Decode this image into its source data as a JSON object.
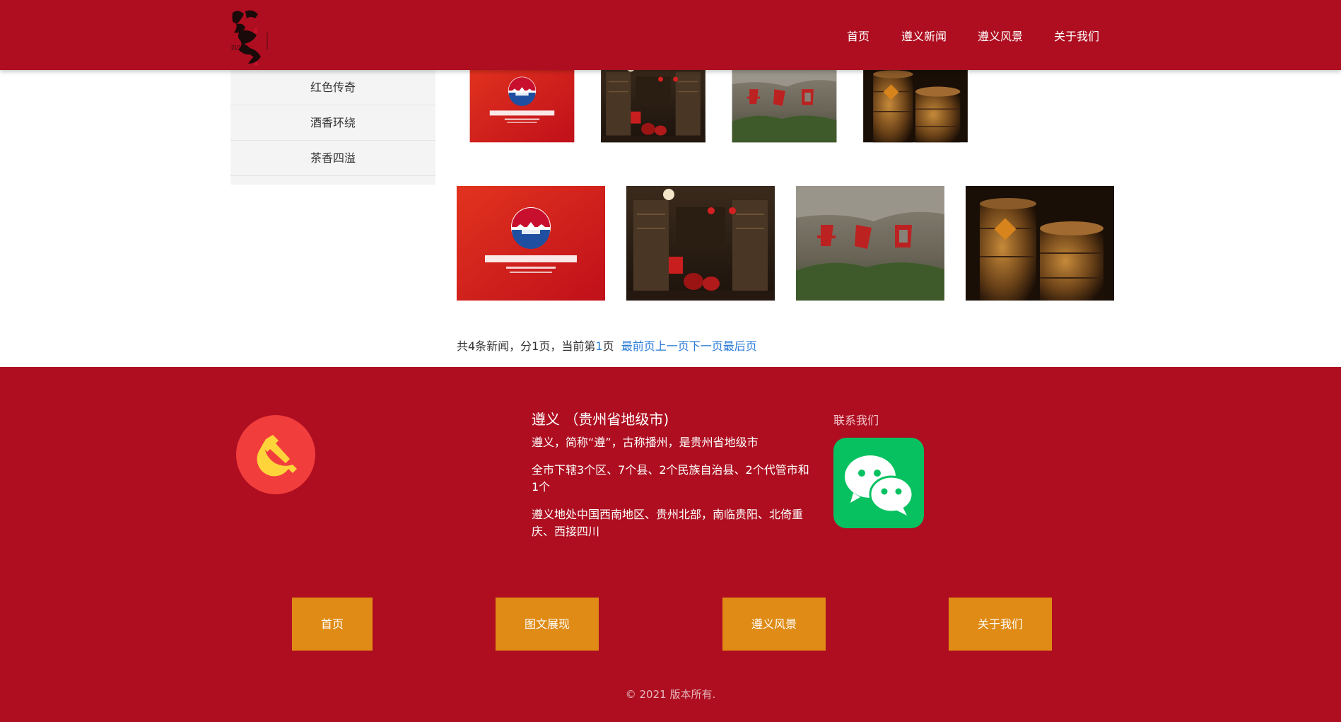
{
  "header": {
    "logo_alt": "醉美遵义",
    "nav": [
      "首页",
      "遵义新闻",
      "遵义风景",
      "关于我们"
    ]
  },
  "sidebar": {
    "items": [
      "红色传奇",
      "酒香环绕",
      "茶香四溢"
    ]
  },
  "gallery": {
    "thumbs": [
      "moutai",
      "inn-interior",
      "cliff-carving",
      "wine-vats"
    ],
    "photos": [
      "moutai",
      "inn-interior",
      "cliff-carving",
      "wine-vats"
    ]
  },
  "pagination": {
    "summary_a": "共4条新闻，分1页，当前第",
    "current": "1",
    "summary_b": "页",
    "first": "最前页",
    "prev": "上一页",
    "next": "下一页",
    "last": "最后页"
  },
  "footer": {
    "title": "遵义 （贵州省地级市)",
    "lines": [
      "遵义，简称“遵”，古称播州，是贵州省地级市",
      "全市下辖3个区、7个县、2个民族自治县、2个代管市和1个",
      "遵义地处中国西南地区、贵州北部，南临贵阳、北倚重庆、西接四川"
    ],
    "contact_label": "联系我们",
    "buttons": [
      "首页",
      "图文展现",
      "遵义风景",
      "关于我们"
    ],
    "copyright": "© 2021 版本所有."
  },
  "colors": {
    "brand_red": "#ae0e20",
    "button_gold": "#df8b15",
    "link_blue": "#2a7bd8",
    "wechat_green": "#07c160",
    "emblem_red": "#f23d3d"
  },
  "icons": {
    "party": "hammer-sickle-icon",
    "wechat": "wechat-icon"
  }
}
